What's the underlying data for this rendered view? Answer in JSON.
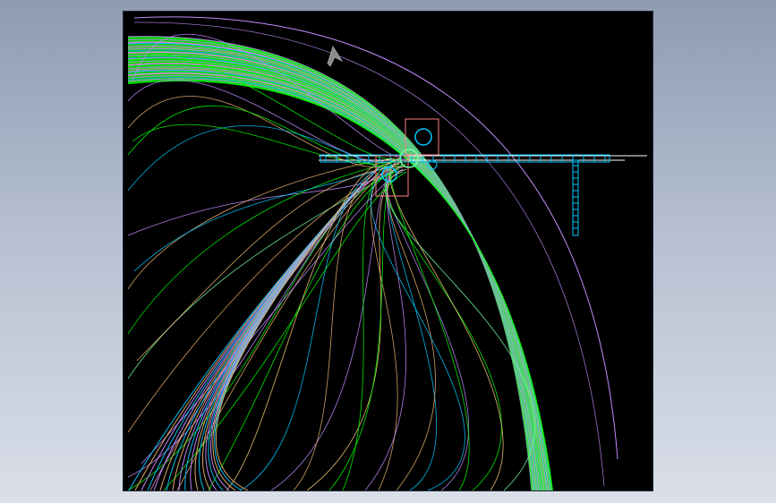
{
  "viewport": {
    "background_color": "#000000",
    "palette": [
      "#00ff00",
      "#c38cff",
      "#e8b06c",
      "#ff9fd6",
      "#00c8ff",
      "#73ffa4",
      "#ffd27a",
      "#ffffff"
    ]
  },
  "icons": {
    "arrow": "north-arrow-icon",
    "drawing": "wireframe-drawing"
  }
}
